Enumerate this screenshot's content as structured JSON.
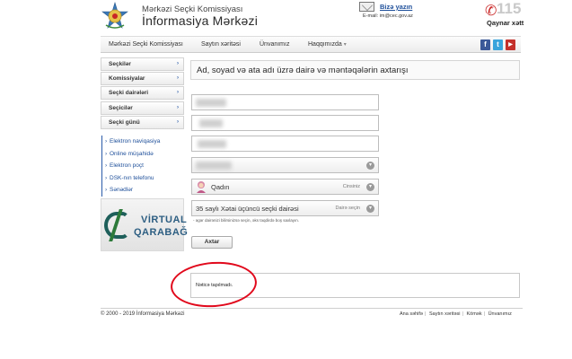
{
  "header": {
    "site_name_line1": "Mərkəzi Seçki Komissiyası",
    "site_name_line2": "İnformasiya Mərkəzi",
    "write_us": "Bizə yazın",
    "email": "E-mail: im@cec.gov.az",
    "hotline_number": "115",
    "hotline_label": "Qaynar xətt"
  },
  "nav": {
    "items": [
      "Mərkəzi Seçki Komissiyası",
      "Saytın xəritəsi",
      "Ünvanımız",
      "Haqqımızda"
    ],
    "social": [
      "facebook-icon",
      "twitter-icon",
      "youtube-icon"
    ]
  },
  "sidebar": {
    "menu": [
      "Seçkilər",
      "Komissiyalar",
      "Seçki dairələri",
      "Seçicilər",
      "Seçki günü"
    ],
    "links": [
      "Elektron naviqasiya",
      "Online müşahidə",
      "Elektron poçt",
      "DSK-nın telefonu",
      "Sənədlər"
    ],
    "banner_line1": "VİRTUAL",
    "banner_line2": "QARABAĞ"
  },
  "form": {
    "heading": "Ad, soyad və ata adı üzrə dairə və məntəqələrin axtarışı",
    "gender_value": "Qadın",
    "gender_hint": "Cinsiniz",
    "district_value": "35 saylı Xətai üçüncü seçki dairəsi",
    "district_hint": "Dairə seçin",
    "note": "- əgər dairənizi bilirsinizsə seçin, əks təqdirdə boş saxlayın.",
    "search_button": "Axtar"
  },
  "result": {
    "message": "Nəticə tapılmadı."
  },
  "footer": {
    "copyright": "© 2000 - 2019 İnformasiya Mərkəzi",
    "links": [
      "Ana səhifə",
      "Saytın xəritəsi",
      "Kömək",
      "Ünvanımız"
    ]
  },
  "colors": {
    "link_blue": "#1e4f9a",
    "annotation_red": "#e1091c",
    "hotline_red": "#c92626"
  }
}
